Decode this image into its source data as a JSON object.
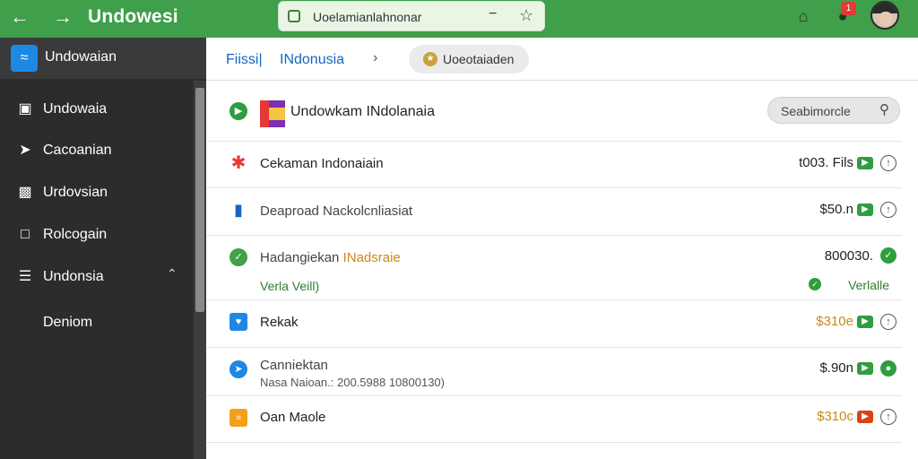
{
  "topbar": {
    "title": "Undowesi",
    "back_icon": "arrow-left-icon",
    "forward_icon": "arrow-right-icon",
    "address_text": "Uoelamianlahnonar",
    "home_icon": "home-icon",
    "notification_badge": "1",
    "colors": {
      "bar": "#3f9f4a",
      "address_bg": "#eaf5e6"
    }
  },
  "sidebar": {
    "title": "Undowaian",
    "items": [
      {
        "label": "Undowaia",
        "icon": "card-icon"
      },
      {
        "label": "Cacoanian",
        "icon": "megaphone-icon"
      },
      {
        "label": "Urdovsian",
        "icon": "image-icon"
      },
      {
        "label": "Rolcogain",
        "icon": "square-icon"
      },
      {
        "label": "Undonsia",
        "icon": "stack-icon",
        "expanded": true
      }
    ],
    "subitems": [
      {
        "label": "Deniom"
      }
    ]
  },
  "breadcrumb": {
    "first": "Fiissi|",
    "second": "INdonusia",
    "separator": "›",
    "chip_label": "Uoeotaiaden"
  },
  "header_row": {
    "title": "Undowkam INdolanaia",
    "search_label": "Seabimorcle"
  },
  "rows": [
    {
      "title": "Cekaman Indonaiain",
      "amount": "t003. Fils",
      "tag_color": "#2e9e3e",
      "status": "clock",
      "icon_color": "#e53935",
      "amount_color": "#222222"
    },
    {
      "title": "Deaproad Nackolcnliasiat",
      "amount": "$50.n",
      "tag_color": "#2e9e3e",
      "status": "clock",
      "icon_color": "#1565c0",
      "amount_color": "#222222"
    },
    {
      "title": "Hadangiekan",
      "title_highlight": "INadsraie",
      "subtitle": "Verla Veill)",
      "amount": "800030.",
      "status": "ok",
      "status_label": "Verlalle",
      "icon_color": "#43a047",
      "amount_color": "#222222"
    },
    {
      "title": "Rekak",
      "amount": "$310e",
      "tag_color": "#2e9e3e",
      "status": "clock",
      "icon_color": "#1e88e5",
      "amount_color": "#c9891e"
    },
    {
      "title": "Canniektan",
      "subtitle": "Nasa Naioan.: 200.5988 10800130)",
      "amount": "$.90n",
      "tag_color": "#2e9e3e",
      "status": "ok",
      "icon_color": "#1e88e5",
      "amount_color": "#222222"
    },
    {
      "title": "Oan Maole",
      "amount": "$310c",
      "tag_color": "#d84315",
      "status": "clock",
      "icon_color": "#f2a11b",
      "amount_color": "#c9891e"
    }
  ]
}
